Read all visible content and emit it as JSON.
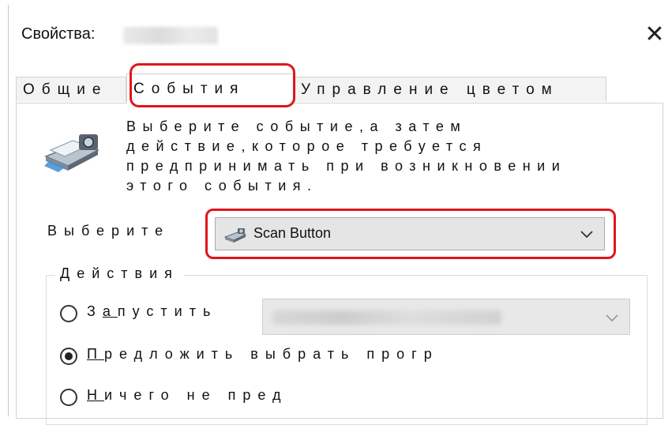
{
  "window": {
    "title": "Свойства:",
    "close_glyph": "✕"
  },
  "tabs": [
    {
      "label": "Общие"
    },
    {
      "label": "События",
      "selected": true
    },
    {
      "label": "Управление цветом"
    }
  ],
  "events_panel": {
    "description": "Выберите событие,а затем действие,которое требуется предпринимать при возникновении этого события.",
    "select_label": "Выберите",
    "event_dropdown": {
      "value": "Scan Button",
      "icon": "scanner-icon"
    }
  },
  "actions": {
    "group_title": "Действия",
    "launch": {
      "prefix": "З",
      "underlined": "а",
      "suffix": "пустить",
      "checked": false
    },
    "suggest": {
      "underlined": "П",
      "suffix": "редложить выбрать прогр",
      "checked": true
    },
    "nothing": {
      "underlined": "Н",
      "suffix": "ичего не пред",
      "checked": false
    }
  },
  "colors": {
    "highlight": "#e0161b",
    "dropdown_bg": "#e5e5e5"
  }
}
